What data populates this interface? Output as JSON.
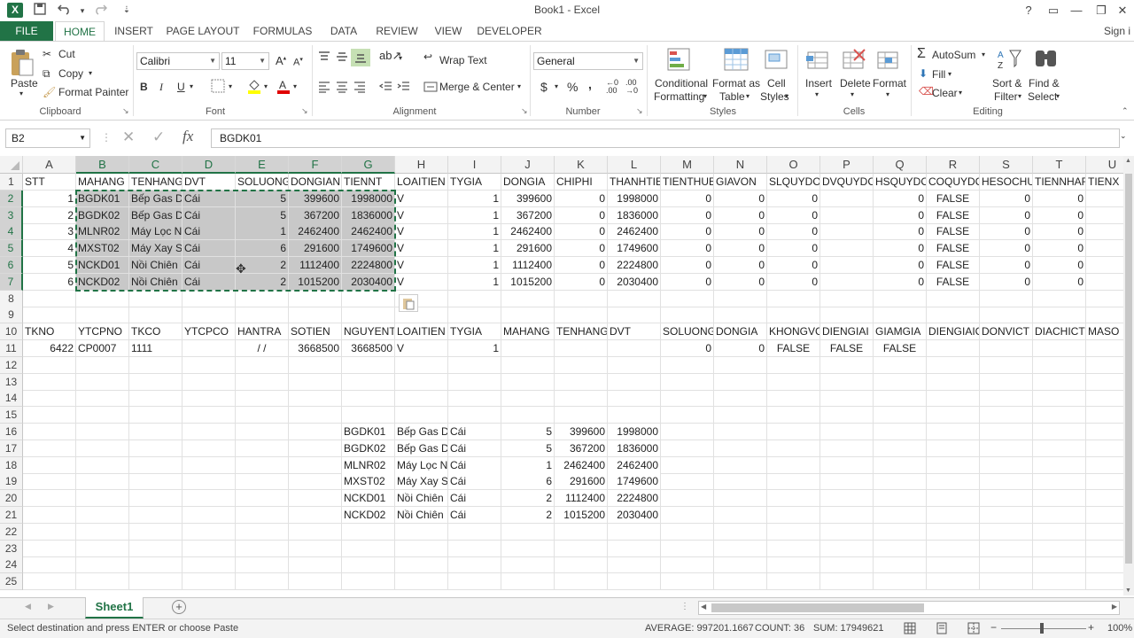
{
  "window": {
    "title": "Book1 - Excel",
    "help": "?",
    "signin": "Sign i"
  },
  "qat": {
    "save_icon": "save-icon",
    "undo_icon": "undo-icon",
    "redo_icon": "redo-icon"
  },
  "tabs": [
    "FILE",
    "HOME",
    "INSERT",
    "PAGE LAYOUT",
    "FORMULAS",
    "DATA",
    "REVIEW",
    "VIEW",
    "DEVELOPER"
  ],
  "active_tab": "HOME",
  "ribbon": {
    "clipboard": {
      "paste": "Paste",
      "cut": "Cut",
      "copy": "Copy",
      "format_painter": "Format Painter",
      "label": "Clipboard"
    },
    "font": {
      "name": "Calibri",
      "size": "11",
      "bold": "B",
      "italic": "I",
      "underline": "U",
      "label": "Font"
    },
    "alignment": {
      "wrap": "Wrap Text",
      "merge": "Merge & Center",
      "label": "Alignment"
    },
    "number": {
      "format": "General",
      "currency": "$",
      "percent": "%",
      "comma": ",",
      "label": "Number"
    },
    "styles": {
      "conditional": "Conditional",
      "conditional2": "Formatting",
      "format_as": "Format as",
      "format_as2": "Table",
      "cell": "Cell",
      "cell2": "Styles",
      "label": "Styles"
    },
    "cells": {
      "insert": "Insert",
      "delete": "Delete",
      "format": "Format",
      "label": "Cells"
    },
    "editing": {
      "autosum": "AutoSum",
      "fill": "Fill",
      "clear": "Clear",
      "sort": "Sort &",
      "sort2": "Filter",
      "find": "Find &",
      "find2": "Select",
      "label": "Editing"
    }
  },
  "formula_bar": {
    "name_box": "B2",
    "fx": "fx",
    "content": "BGDK01"
  },
  "columns": [
    "A",
    "B",
    "C",
    "D",
    "E",
    "F",
    "G",
    "H",
    "I",
    "J",
    "K",
    "L",
    "M",
    "N",
    "O",
    "P",
    "Q",
    "R",
    "S",
    "T",
    "U"
  ],
  "rows": [
    "1",
    "2",
    "3",
    "4",
    "5",
    "6",
    "7",
    "8",
    "9",
    "10",
    "11",
    "12",
    "13",
    "14",
    "15",
    "16",
    "17",
    "18",
    "19",
    "20",
    "21",
    "22",
    "23",
    "24",
    "25"
  ],
  "cells": {
    "r1": [
      "STT",
      "MAHANG",
      "TENHANG",
      "DVT",
      "SOLUONG",
      "DONGIAN",
      "TIENNT",
      "LOAITIEN",
      "TYGIA",
      "DONGIA",
      "CHIPHI",
      "THANHTIE",
      "TIENTHUE",
      "GIAVON",
      "SLQUYDOI",
      "DVQUYDC",
      "HSQUYDO",
      "COQUYDC",
      "HESOCHU",
      "TIENNHAF",
      "TIENX"
    ],
    "r2": [
      "1",
      "BGDK01",
      "Bếp Gas D",
      "Cái",
      "5",
      "399600",
      "1998000",
      "V",
      "1",
      "399600",
      "0",
      "1998000",
      "0",
      "0",
      "0",
      "",
      "0",
      "FALSE",
      "0",
      "0",
      ""
    ],
    "r3": [
      "2",
      "BGDK02",
      "Bếp Gas D",
      "Cái",
      "5",
      "367200",
      "1836000",
      "V",
      "1",
      "367200",
      "0",
      "1836000",
      "0",
      "0",
      "0",
      "",
      "0",
      "FALSE",
      "0",
      "0",
      ""
    ],
    "r4": [
      "3",
      "MLNR02",
      "Máy Lọc N",
      "Cái",
      "1",
      "2462400",
      "2462400",
      "V",
      "1",
      "2462400",
      "0",
      "2462400",
      "0",
      "0",
      "0",
      "",
      "0",
      "FALSE",
      "0",
      "0",
      ""
    ],
    "r5": [
      "4",
      "MXST02",
      "Máy Xay S",
      "Cái",
      "6",
      "291600",
      "1749600",
      "V",
      "1",
      "291600",
      "0",
      "1749600",
      "0",
      "0",
      "0",
      "",
      "0",
      "FALSE",
      "0",
      "0",
      ""
    ],
    "r6": [
      "5",
      "NCKD01",
      "Nồi Chiên",
      "Cái",
      "2",
      "1112400",
      "2224800",
      "V",
      "1",
      "1112400",
      "0",
      "2224800",
      "0",
      "0",
      "0",
      "",
      "0",
      "FALSE",
      "0",
      "0",
      ""
    ],
    "r7": [
      "6",
      "NCKD02",
      "Nồi Chiên",
      "Cái",
      "2",
      "1015200",
      "2030400",
      "V",
      "1",
      "1015200",
      "0",
      "2030400",
      "0",
      "0",
      "0",
      "",
      "0",
      "FALSE",
      "0",
      "0",
      ""
    ],
    "r10": [
      "TKNO",
      "YTCPNO",
      "TKCO",
      "YTCPCO",
      "HANTRA",
      "SOTIEN",
      "NGUYENT",
      "LOAITIEN",
      "TYGIA",
      "MAHANG",
      "TENHANG",
      "DVT",
      "SOLUONG",
      "DONGIA",
      "KHONGVC",
      "DIENGIAI",
      "GIAMGIA",
      "DIENGIAIC",
      "DONVICT",
      "DIACHICT",
      "MASO"
    ],
    "r11": [
      "6422",
      "CP0007",
      "1111",
      "",
      "/ /",
      "3668500",
      "3668500",
      "V",
      "1",
      "",
      "",
      "",
      "0",
      "0",
      "FALSE",
      "FALSE",
      "FALSE",
      "",
      "",
      "",
      ""
    ],
    "lower": [
      [
        "BGDK01",
        "Bếp Gas D",
        "Cái",
        "5",
        "399600",
        "1998000"
      ],
      [
        "BGDK02",
        "Bếp Gas D",
        "Cái",
        "5",
        "367200",
        "1836000"
      ],
      [
        "MLNR02",
        "Máy Lọc N",
        "Cái",
        "1",
        "2462400",
        "2462400"
      ],
      [
        "MXST02",
        "Máy Xay S",
        "Cái",
        "6",
        "291600",
        "1749600"
      ],
      [
        "NCKD01",
        "Nồi Chiên",
        "Cái",
        "2",
        "1112400",
        "2224800"
      ],
      [
        "NCKD02",
        "Nồi Chiên",
        "Cái",
        "2",
        "1015200",
        "2030400"
      ]
    ]
  },
  "sheet": {
    "name": "Sheet1",
    "add": "+"
  },
  "status": {
    "message": "Select destination and press ENTER or choose Paste",
    "average": "AVERAGE: 997201.1667",
    "count": "COUNT: 36",
    "sum": "SUM: 17949621",
    "zoom": "100%"
  }
}
